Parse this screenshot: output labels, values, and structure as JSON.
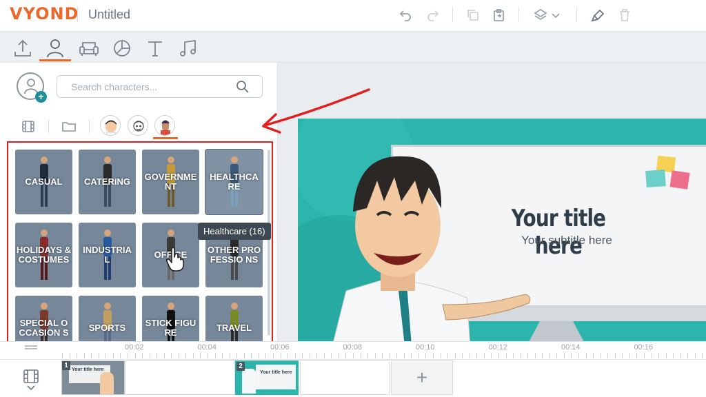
{
  "app": {
    "logo": "VYOND",
    "doc_title": "Untitled"
  },
  "toolbar": {
    "icons": [
      "undo-icon",
      "redo-icon",
      "copy-icon",
      "paste-icon",
      "layers-icon",
      "chevron-down-icon",
      "brush-icon",
      "trash-icon"
    ]
  },
  "tabs": [
    {
      "name": "upload",
      "icon": "upload-icon"
    },
    {
      "name": "characters",
      "icon": "person-icon",
      "active": true
    },
    {
      "name": "props",
      "icon": "sofa-icon"
    },
    {
      "name": "charts",
      "icon": "pie-chart-icon"
    },
    {
      "name": "text",
      "icon": "text-icon"
    },
    {
      "name": "audio",
      "icon": "music-icon"
    }
  ],
  "search": {
    "placeholder": "Search characters..."
  },
  "categories": [
    {
      "label": "CASUAL"
    },
    {
      "label": "CATERING"
    },
    {
      "label": "GOVERNME NT"
    },
    {
      "label": "HEALTHCA RE"
    },
    {
      "label": "HOLIDAYS & COSTUMES"
    },
    {
      "label": "INDUSTRIA L"
    },
    {
      "label": "OFFICE"
    },
    {
      "label": "OTHER PROFESSIO NS"
    },
    {
      "label": "SPECIAL OCCASION S"
    },
    {
      "label": "SPORTS"
    },
    {
      "label": "STICK FIGURE"
    },
    {
      "label": "TRAVEL"
    }
  ],
  "tooltip": "Healthcare (16)",
  "slide": {
    "title": "Your title here",
    "subtitle": "Your subtitle here"
  },
  "timeline": {
    "ticks": [
      "00:02",
      "00:04",
      "00:06",
      "00:08",
      "00:10",
      "00:12",
      "00:14",
      "00:16"
    ],
    "scenes": [
      {
        "number": "1",
        "thumb_title": "Your title here"
      },
      {
        "number": "2",
        "thumb_title": "Your title here"
      }
    ],
    "add_label": "+"
  },
  "colors": {
    "brand": "#e9682a",
    "tile": "#76879a",
    "slide_bg": "#2bb5ad",
    "highlight": "#e02020"
  }
}
